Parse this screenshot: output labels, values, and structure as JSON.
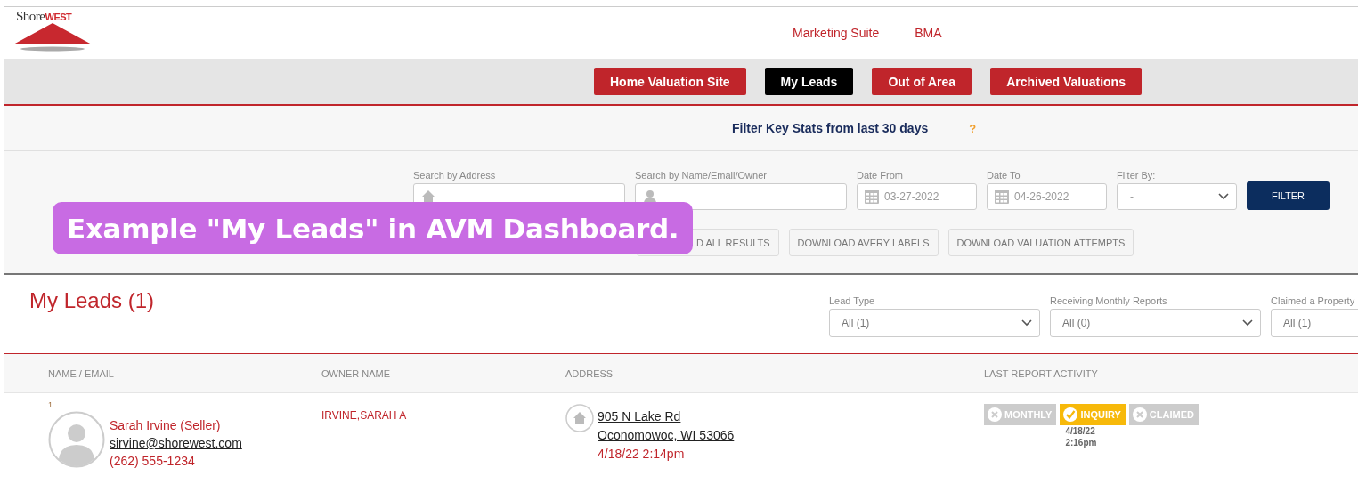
{
  "logo": {
    "brand": "Shore",
    "brand_accent": "WEST"
  },
  "header_links": [
    "Marketing Suite",
    "BMA"
  ],
  "tabs": [
    {
      "label": "Home Valuation Site",
      "selected": false
    },
    {
      "label": "My Leads",
      "selected": true
    },
    {
      "label": "Out of Area",
      "selected": false
    },
    {
      "label": "Archived Valuations",
      "selected": false
    }
  ],
  "key_stats": {
    "title": "Filter Key Stats from last 30 days",
    "help": "?"
  },
  "search_fields": [
    {
      "kind": "house-text",
      "label": "Search by Address"
    },
    {
      "kind": "person-text",
      "label": "Search by Name/Email/Owner"
    },
    {
      "kind": "date",
      "label": "Date From",
      "value": "03-27-2022"
    },
    {
      "kind": "date",
      "label": "Date To",
      "value": "04-26-2022"
    },
    {
      "kind": "select",
      "label": "Filter By:",
      "value": "-"
    }
  ],
  "filter_button": "FILTER",
  "downloads": [
    "D ALL RESULTS",
    "DOWNLOAD AVERY LABELS",
    "DOWNLOAD VALUATION ATTEMPTS"
  ],
  "leads": {
    "title": "My Leads (1)",
    "filters": [
      {
        "label": "Lead Type",
        "value": "All (1)"
      },
      {
        "label": "Receiving Monthly Reports",
        "value": "All (0)"
      },
      {
        "label": "Claimed a Property",
        "value": "All (1)"
      }
    ]
  },
  "table": {
    "columns": [
      "NAME / EMAIL",
      "OWNER NAME",
      "ADDRESS",
      "LAST REPORT ACTIVITY"
    ],
    "rows": [
      {
        "index": "1",
        "name": "Sarah Irvine (Seller)",
        "email": "sirvine@shorewest.com",
        "phone": "(262) 555-1234",
        "owner": "IRVINE,SARAH A",
        "address_line1": "905 N Lake Rd",
        "address_line2": "Oconomowoc, WI 53066",
        "date": "4/18/22 2:14pm",
        "activity": [
          {
            "label": "MONTHLY",
            "on": false
          },
          {
            "label": "INQUIRY",
            "on": true,
            "date": "4/18/22",
            "time": "2:16pm"
          },
          {
            "label": "CLAIMED",
            "on": false
          }
        ]
      }
    ]
  },
  "annotation": "Example \"My Leads\" in AVM Dashboard."
}
